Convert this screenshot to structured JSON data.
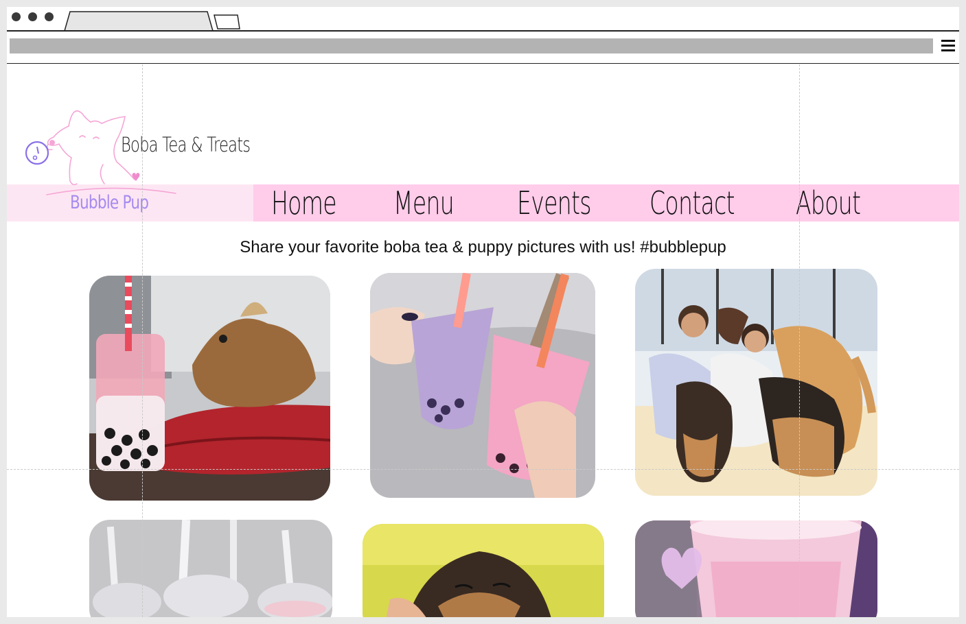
{
  "browser": {
    "url": "",
    "menu_icon": "hamburger-icon"
  },
  "site": {
    "tagline": "Boba Tea & Treats",
    "brand": "Bubble Pup",
    "logo_icon": "puppy-logo-icon"
  },
  "nav": {
    "items": [
      {
        "label": "Home"
      },
      {
        "label": "Menu"
      },
      {
        "label": "Events"
      },
      {
        "label": "Contact"
      },
      {
        "label": "About"
      }
    ]
  },
  "main": {
    "headline": "Share your favorite boba tea & puppy pictures with us! #bubblepup"
  },
  "colors": {
    "nav_bg": "#ffccea",
    "logo_band_bg": "#fde6f3",
    "brand_text": "#a58bf0",
    "logo_line": "#f5a6d6"
  }
}
